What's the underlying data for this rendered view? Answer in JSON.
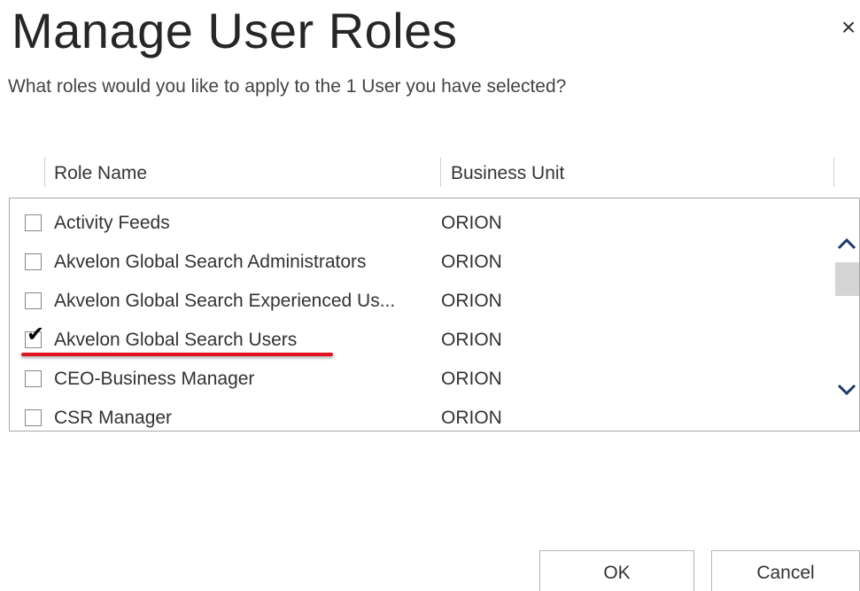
{
  "dialog": {
    "title": "Manage User Roles",
    "subtitle": "What roles would you like to apply to the 1 User you have selected?",
    "close_icon": "close-icon",
    "close_glyph": "×"
  },
  "grid": {
    "columns": [
      "Role Name",
      "Business Unit"
    ],
    "rows": [
      {
        "role": "Activity Feeds",
        "business_unit": "ORION",
        "checked": false
      },
      {
        "role": "Akvelon Global Search Administrators",
        "business_unit": "ORION",
        "checked": false
      },
      {
        "role": "Akvelon Global Search Experienced Us...",
        "business_unit": "ORION",
        "checked": false
      },
      {
        "role": "Akvelon Global Search Users",
        "business_unit": "ORION",
        "checked": true
      },
      {
        "role": "CEO-Business Manager",
        "business_unit": "ORION",
        "checked": false
      },
      {
        "role": "CSR Manager",
        "business_unit": "ORION",
        "checked": false
      }
    ],
    "highlight_color": "#e2141f",
    "check_glyph": "✔"
  },
  "buttons": {
    "ok_label": "OK",
    "cancel_label": "Cancel"
  }
}
